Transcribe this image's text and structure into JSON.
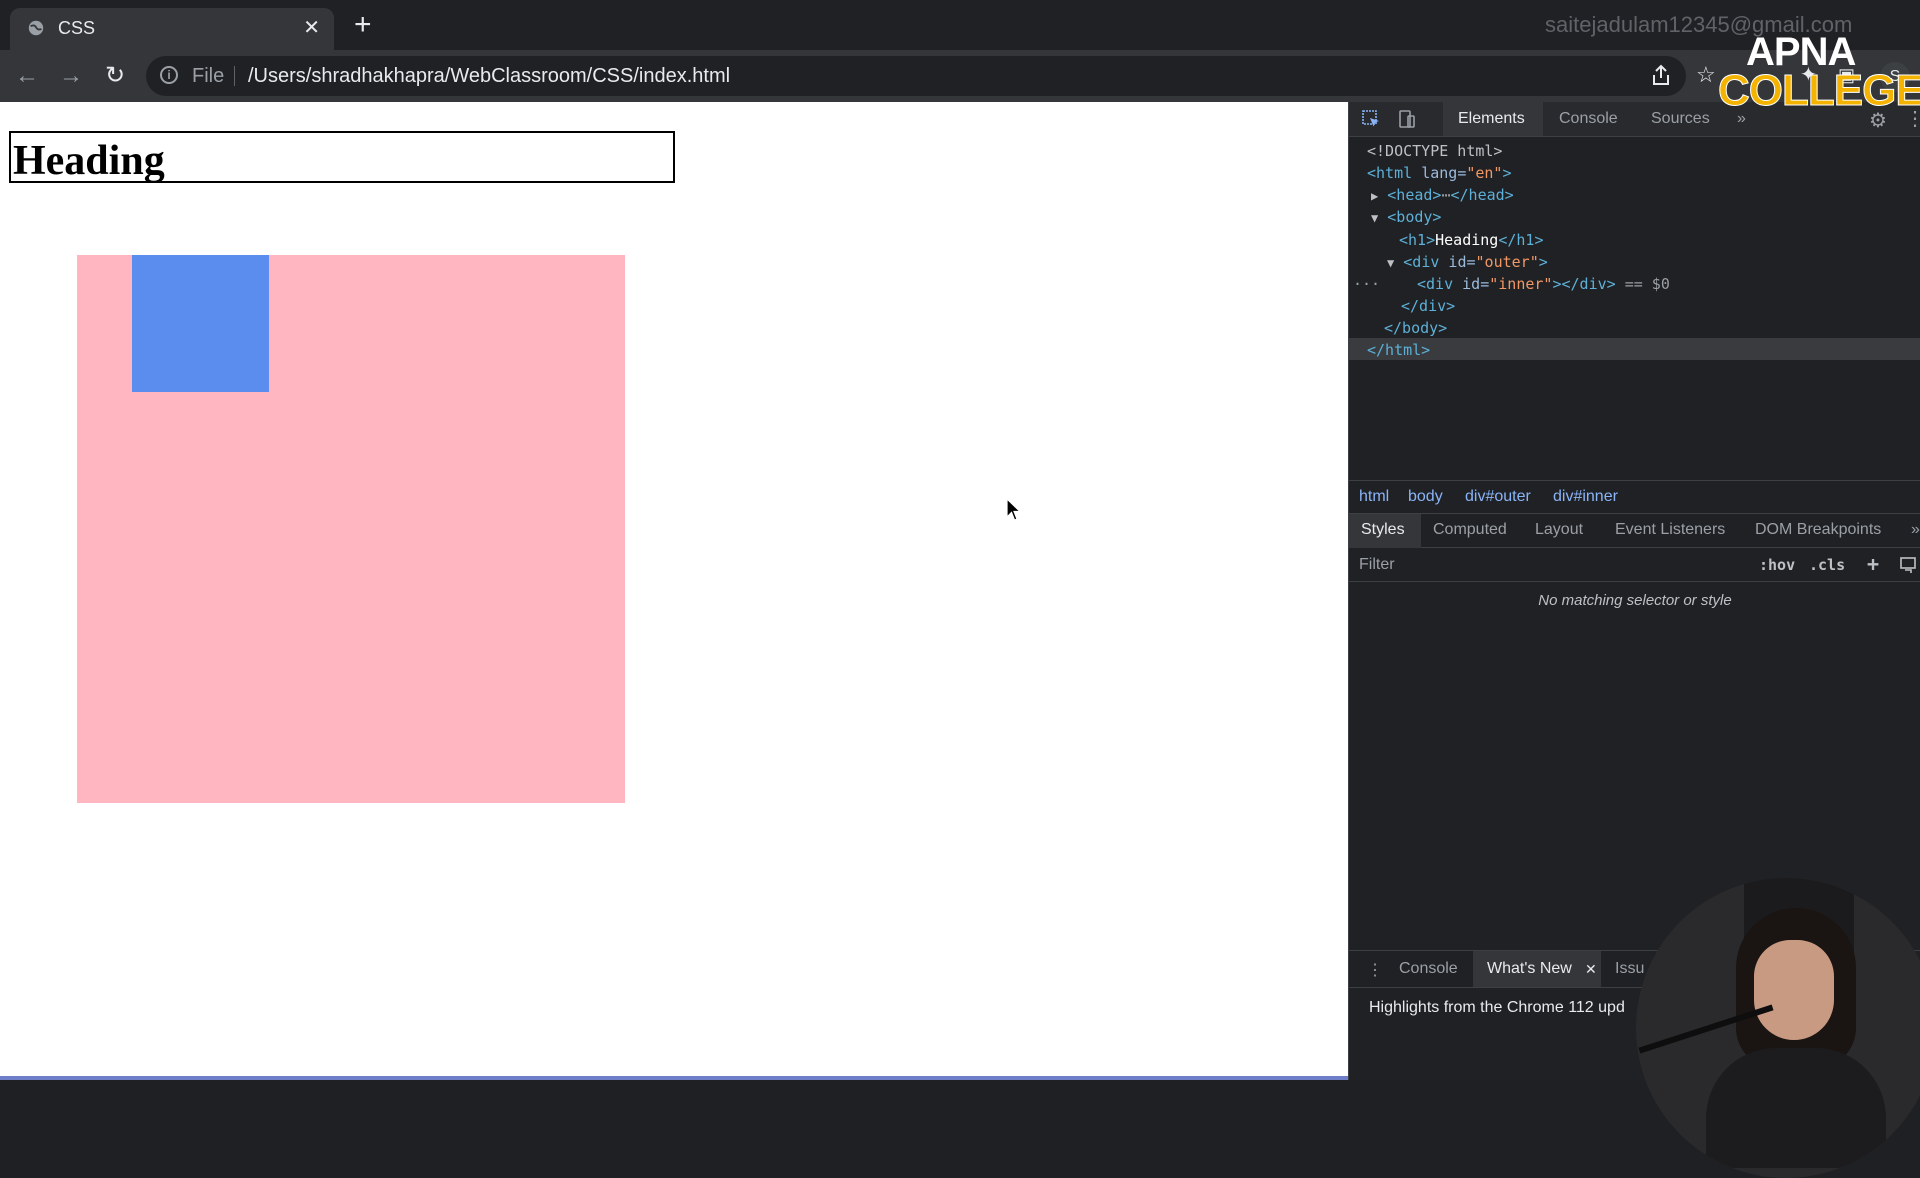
{
  "browser": {
    "tab_title": "CSS",
    "close_glyph": "✕",
    "new_tab_glyph": "+",
    "account_email": "saitejadulam12345@gmail.com",
    "url_scheme": "File",
    "url": "/Users/shradhakhapra/WebClassroom/CSS/index.html",
    "profile_initial": "S",
    "icons": [
      "globe-icon",
      "back-arrow-icon",
      "forward-arrow-icon",
      "reload-icon",
      "info-icon",
      "share-icon",
      "star-icon",
      "extensions-icon",
      "sidepanel-icon"
    ]
  },
  "logo": {
    "line1": "APNA",
    "line2": "COLLEGE"
  },
  "page": {
    "heading": "Heading",
    "colors": {
      "outer": "#ffb6c1",
      "inner": "#5b8def"
    }
  },
  "devtools": {
    "tabs": [
      "Elements",
      "Console",
      "Sources"
    ],
    "more_tabs_glyph": "»",
    "dom": {
      "doctype": "<!DOCTYPE html>",
      "html_tag": "html",
      "html_attr": "lang",
      "html_lang": "\"en\"",
      "head_open": "<head>",
      "head_ellipsis": "⋯",
      "head_close": "</head>",
      "body_open": "<body>",
      "h1_open": "<h1>",
      "h1_text": "Heading",
      "h1_close": "</h1>",
      "div": "div",
      "id_attr": "id",
      "outer_id": "\"outer\"",
      "inner_id": "\"inner\"",
      "div_close": "</div>",
      "selected_marker": "== $0",
      "body_close": "</body>",
      "html_close": "</html>",
      "row_dots": "···"
    },
    "breadcrumbs": [
      "html",
      "body",
      "div#outer",
      "div#inner"
    ],
    "styles_tabs": [
      "Styles",
      "Computed",
      "Layout",
      "Event Listeners",
      "DOM Breakpoints"
    ],
    "filter_placeholder": "Filter",
    "hov_label": ":hov",
    "cls_label": ".cls",
    "add_rule_glyph": "+",
    "no_match_text": "No matching selector or style",
    "drawer": {
      "tabs": [
        "Console",
        "What's New",
        "Issu"
      ],
      "whats_new_close": "✕",
      "highlight_text": "Highlights from the Chrome 112 upd"
    }
  }
}
